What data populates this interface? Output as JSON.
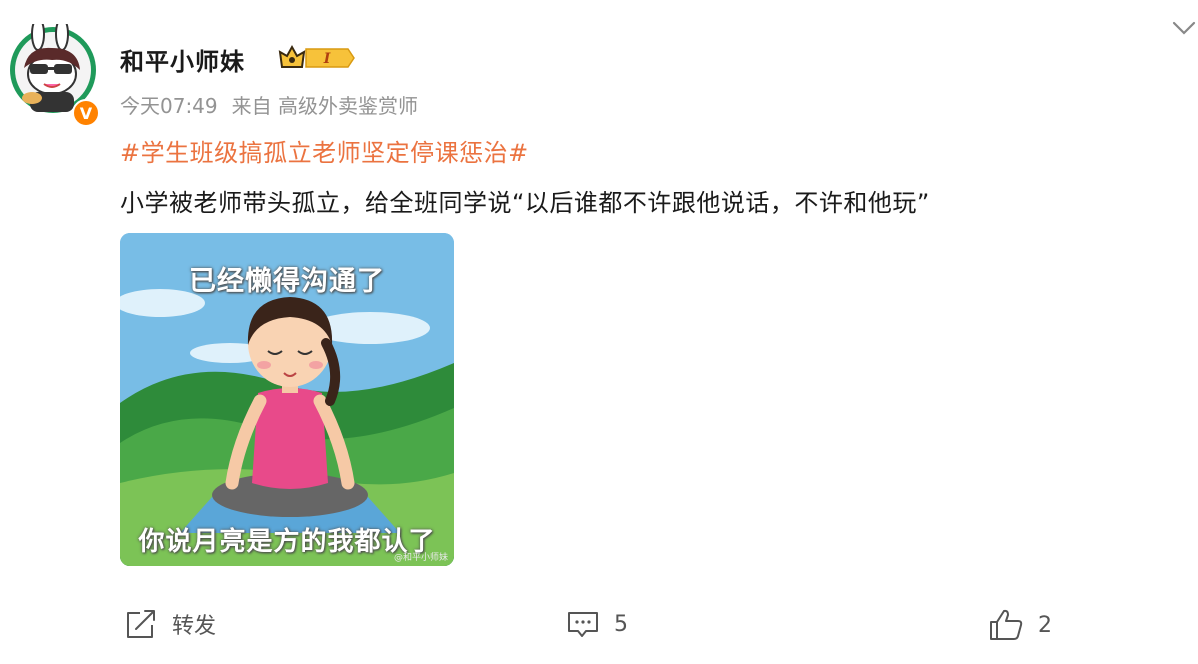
{
  "user": {
    "name": "和平小师妹",
    "verified_badge": "V",
    "level_badge": "I"
  },
  "meta": {
    "time": "今天07:49",
    "source": "来自 高级外卖鉴赏师"
  },
  "post": {
    "hashtag": "#学生班级搞孤立老师坚定停课惩治#",
    "text": "小学被老师带头孤立，给全班同学说“以后谁都不许跟他说话，不许和他玩”"
  },
  "image": {
    "top_caption": "已经懒得沟通了",
    "bottom_caption": "你说月亮是方的我都认了",
    "watermark": "@和平小师妹"
  },
  "actions": {
    "repost_label": "转发",
    "comment_count": "5",
    "like_count": "2"
  },
  "colors": {
    "hashtag": "#eb7340",
    "meta": "#939393",
    "verified": "#ff8200"
  },
  "icons": [
    "avatar",
    "crown-level-badge-icon",
    "chevron-down-icon",
    "repost-icon",
    "comment-icon",
    "like-icon"
  ]
}
